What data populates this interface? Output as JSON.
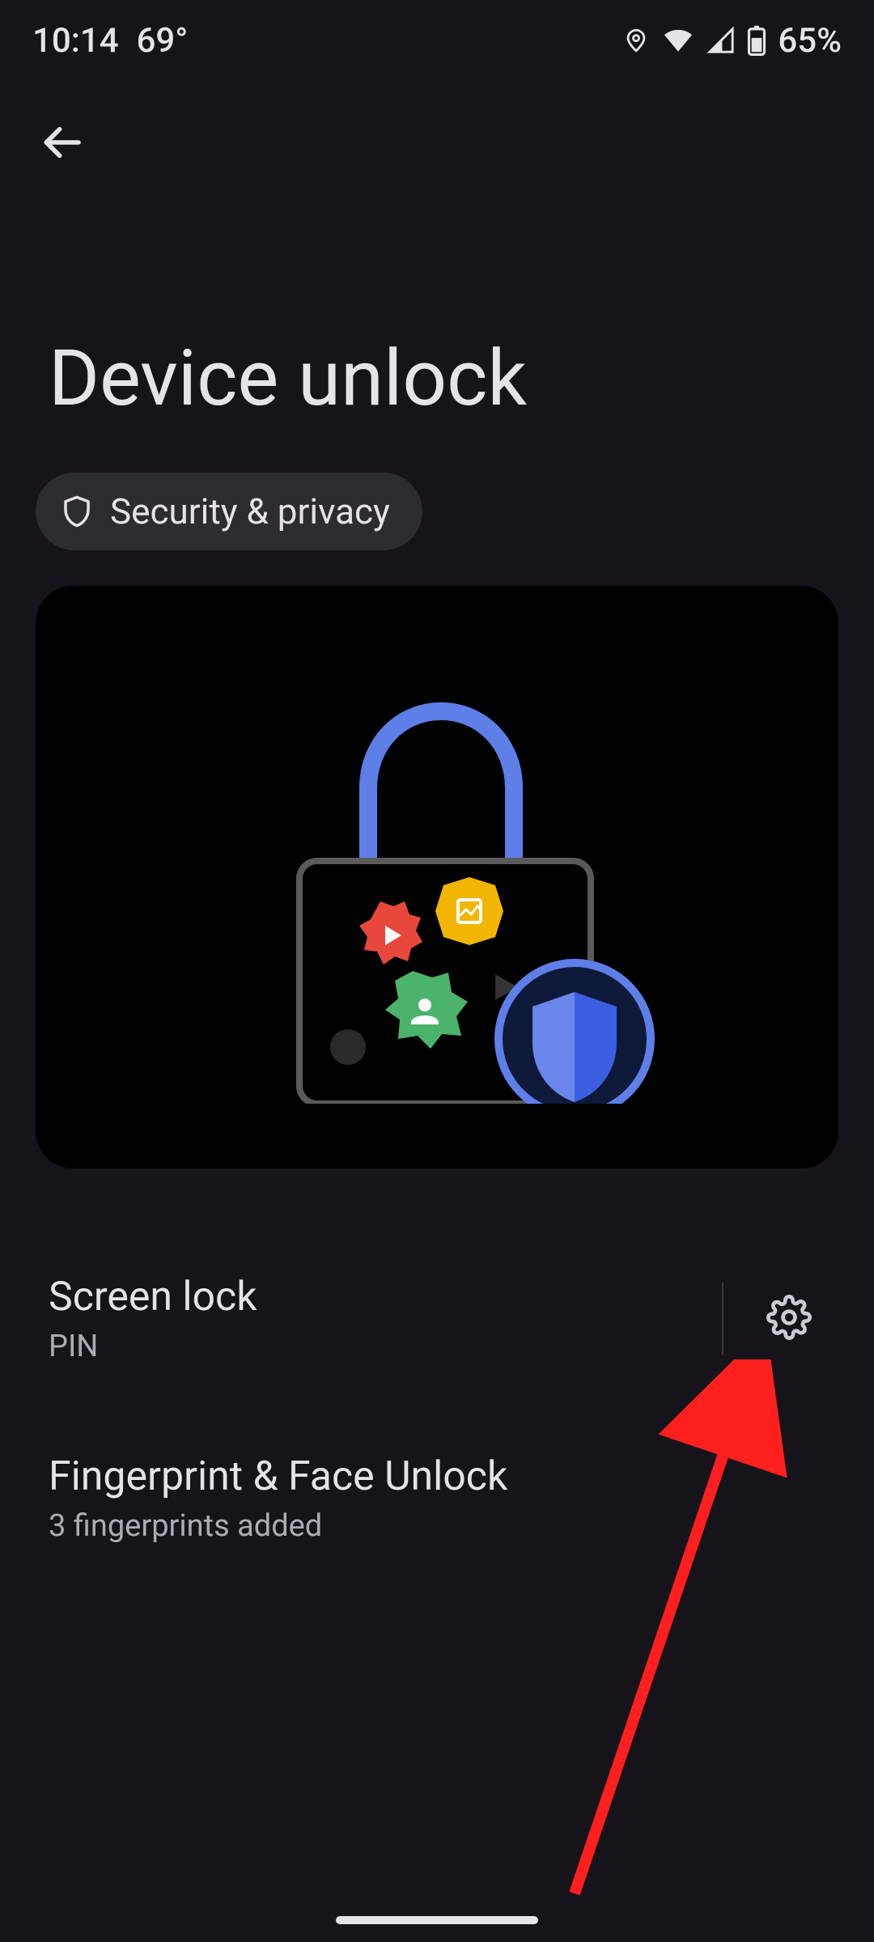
{
  "status": {
    "time": "10:14",
    "temperature": "69°",
    "battery_percent": "65%"
  },
  "page": {
    "title": "Device unlock"
  },
  "chip": {
    "label": "Security & privacy"
  },
  "items": [
    {
      "title": "Screen lock",
      "subtitle": "PIN",
      "has_settings_gear": true
    },
    {
      "title": "Fingerprint & Face Unlock",
      "subtitle": "3 fingerprints added",
      "has_settings_gear": false
    }
  ]
}
